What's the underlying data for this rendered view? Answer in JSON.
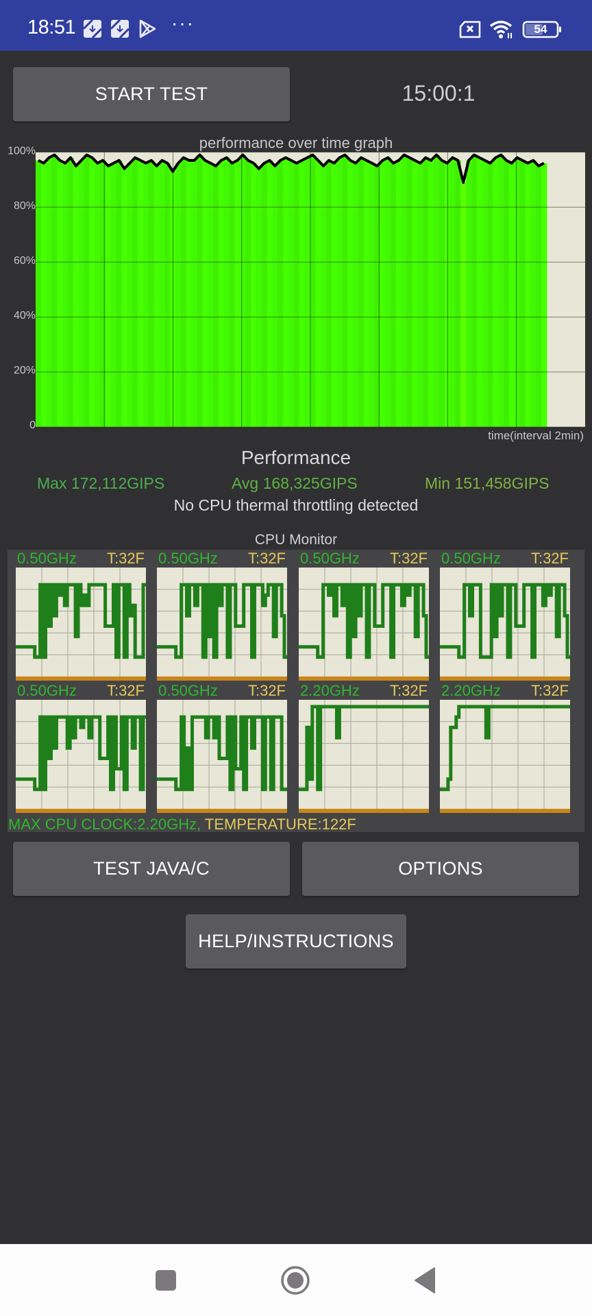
{
  "status_bar": {
    "time": "18:51",
    "notification_icons": [
      "download-box-icon",
      "download-box-icon",
      "play-store-icon"
    ],
    "more_indicator": "···",
    "right_icons": [
      "no-sim-icon",
      "wifi-icon",
      "battery-icon"
    ],
    "battery_level": "54",
    "background_color": "#303f9f"
  },
  "controls": {
    "start_test_label": "START TEST",
    "timer": "15:00:1",
    "test_java_c_label": "TEST JAVA/C",
    "options_label": "OPTIONS",
    "help_label": "HELP/INSTRUCTIONS"
  },
  "performance_graph": {
    "title": "performance over time graph",
    "y_ticks": [
      "100%",
      "80%",
      "60%",
      "40%",
      "20%",
      "0"
    ],
    "x_label": "time(interval 2min)",
    "colors": {
      "fill": "#44ff00",
      "line": "#000000",
      "background": "#e8e6d6",
      "grid": "#2a4a1a"
    }
  },
  "chart_data": {
    "type": "area",
    "title": "performance over time graph",
    "xlabel": "time(interval 2min)",
    "ylabel": "",
    "ylim": [
      0,
      100
    ],
    "y_ticks": [
      0,
      20,
      40,
      60,
      80,
      100
    ],
    "x_intervals_total": 8,
    "x_fraction_filled": 0.93,
    "grid": true,
    "series": [
      {
        "name": "performance %",
        "values": [
          97,
          96,
          98,
          99,
          97,
          96,
          98,
          95,
          97,
          99,
          98,
          96,
          97,
          95,
          96,
          97,
          94,
          96,
          98,
          97,
          96,
          97,
          95,
          97,
          96,
          93,
          96,
          98,
          97,
          97,
          99,
          97,
          96,
          95,
          97,
          98,
          96,
          97,
          99,
          97,
          96,
          94,
          96,
          97,
          95,
          97,
          98,
          97,
          96,
          97,
          98,
          99,
          97,
          95,
          97,
          96,
          98,
          99,
          97,
          96,
          98,
          97,
          96,
          95,
          97,
          98,
          96,
          97,
          99,
          98,
          97,
          96,
          98,
          97,
          99,
          97,
          96,
          98,
          97,
          89,
          97,
          99,
          98,
          97,
          96,
          98,
          99,
          97,
          96,
          98,
          97,
          96,
          97,
          95,
          96
        ]
      }
    ]
  },
  "performance_summary": {
    "title": "Performance",
    "max": "Max 172,112GIPS",
    "avg": "Avg 168,325GIPS",
    "min": "Min 151,458GIPS",
    "throttling": "No CPU thermal throttling detected",
    "colors": {
      "max": "#4caf50",
      "avg": "#5cb342",
      "min": "#7cb342"
    }
  },
  "cpu_monitor": {
    "title": "CPU Monitor",
    "cores": [
      {
        "freq": "0.50GHz",
        "temp": "T:32F",
        "history": [
          0.3,
          0.3,
          0.3,
          0.3,
          0.3,
          0.3,
          0.3,
          0.2,
          0.2,
          0.9,
          0.2,
          0.9,
          0.5,
          0.9,
          0.6,
          0.9,
          0.8,
          0.9,
          0.7,
          0.9,
          0.9,
          0.9,
          0.4,
          0.9,
          0.7,
          0.8,
          0.7,
          0.9,
          0.9,
          0.9,
          0.9,
          0.9,
          0.9,
          0.5,
          0.5,
          0.5,
          0.9,
          0.2,
          0.9,
          0.9,
          0.2,
          0.9,
          0.6,
          0.7,
          0.2,
          0.2,
          0.2,
          0.9
        ]
      },
      {
        "freq": "0.50GHz",
        "temp": "T:32F",
        "history": [
          0.3,
          0.3,
          0.3,
          0.3,
          0.3,
          0.3,
          0.3,
          0.2,
          0.2,
          0.9,
          0.9,
          0.6,
          0.9,
          0.9,
          0.7,
          0.9,
          0.9,
          0.2,
          0.9,
          0.4,
          0.9,
          0.2,
          0.9,
          0.7,
          0.9,
          0.9,
          0.2,
          0.9,
          0.9,
          0.5,
          0.5,
          0.5,
          0.9,
          0.9,
          0.9,
          0.2,
          0.9,
          0.9,
          0.9,
          0.7,
          0.8,
          0.9,
          0.9,
          0.4,
          0.9,
          0.9,
          0.6,
          0.2
        ]
      },
      {
        "freq": "0.50GHz",
        "temp": "T:32F",
        "history": [
          0.3,
          0.3,
          0.3,
          0.3,
          0.3,
          0.3,
          0.3,
          0.2,
          0.2,
          0.9,
          0.9,
          0.8,
          0.9,
          0.6,
          0.9,
          0.9,
          0.7,
          0.9,
          0.2,
          0.9,
          0.4,
          0.9,
          0.6,
          0.9,
          0.9,
          0.2,
          0.9,
          0.9,
          0.5,
          0.5,
          0.5,
          0.9,
          0.9,
          0.9,
          0.2,
          0.9,
          0.9,
          0.9,
          0.7,
          0.9,
          0.8,
          0.9,
          0.9,
          0.4,
          0.9,
          0.9,
          0.6,
          0.2
        ]
      },
      {
        "freq": "0.50GHz",
        "temp": "T:32F",
        "history": [
          0.3,
          0.3,
          0.3,
          0.3,
          0.3,
          0.3,
          0.3,
          0.2,
          0.2,
          0.9,
          0.9,
          0.6,
          0.9,
          0.9,
          0.9,
          0.2,
          0.2,
          0.2,
          0.2,
          0.9,
          0.4,
          0.9,
          0.6,
          0.9,
          0.9,
          0.2,
          0.9,
          0.9,
          0.5,
          0.5,
          0.5,
          0.9,
          0.9,
          0.9,
          0.2,
          0.9,
          0.9,
          0.9,
          0.7,
          0.9,
          0.8,
          0.9,
          0.9,
          0.4,
          0.9,
          0.9,
          0.6,
          0.2
        ]
      },
      {
        "freq": "0.50GHz",
        "temp": "T:32F",
        "history": [
          0.3,
          0.3,
          0.3,
          0.3,
          0.3,
          0.3,
          0.3,
          0.2,
          0.2,
          0.9,
          0.2,
          0.9,
          0.5,
          0.9,
          0.6,
          0.9,
          0.9,
          0.9,
          0.9,
          0.6,
          0.9,
          0.7,
          0.9,
          0.9,
          0.8,
          0.9,
          0.9,
          0.7,
          0.9,
          0.9,
          0.9,
          0.5,
          0.5,
          0.5,
          0.9,
          0.2,
          0.9,
          0.4,
          0.4,
          0.9,
          0.2,
          0.9,
          0.9,
          0.6,
          0.9,
          0.9,
          0.2,
          0.9
        ]
      },
      {
        "freq": "0.50GHz",
        "temp": "T:32F",
        "history": [
          0.3,
          0.3,
          0.3,
          0.3,
          0.3,
          0.3,
          0.3,
          0.2,
          0.2,
          0.9,
          0.2,
          0.6,
          0.2,
          0.9,
          0.9,
          0.9,
          0.9,
          0.9,
          0.7,
          0.9,
          0.9,
          0.7,
          0.9,
          0.5,
          0.5,
          0.5,
          0.9,
          0.2,
          0.9,
          0.4,
          0.4,
          0.9,
          0.2,
          0.9,
          0.9,
          0.6,
          0.9,
          0.9,
          0.9,
          0.2,
          0.9,
          0.9,
          0.2,
          0.9,
          0.9,
          0.9,
          0.2,
          0.2
        ]
      },
      {
        "freq": "2.20GHz",
        "temp": "T:32F",
        "history": [
          0.2,
          0.2,
          0.2,
          0.8,
          0.3,
          1.0,
          1.0,
          0.2,
          1.0,
          1.0,
          1.0,
          1.0,
          1.0,
          1.0,
          0.7,
          1.0,
          1.0,
          1.0,
          1.0,
          1.0,
          1.0,
          1.0,
          1.0,
          1.0,
          1.0,
          1.0,
          1.0,
          1.0,
          1.0,
          1.0,
          1.0,
          1.0,
          1.0,
          1.0,
          1.0,
          1.0,
          1.0,
          1.0,
          1.0,
          1.0,
          1.0,
          1.0,
          1.0,
          1.0,
          1.0,
          1.0,
          1.0,
          1.0
        ]
      },
      {
        "freq": "2.20GHz",
        "temp": "T:32F",
        "history": [
          0.2,
          0.2,
          0.2,
          0.3,
          0.8,
          0.8,
          0.9,
          1.0,
          1.0,
          1.0,
          1.0,
          1.0,
          1.0,
          1.0,
          1.0,
          1.0,
          1.0,
          0.7,
          1.0,
          1.0,
          1.0,
          1.0,
          1.0,
          1.0,
          1.0,
          1.0,
          1.0,
          1.0,
          1.0,
          1.0,
          1.0,
          1.0,
          1.0,
          1.0,
          1.0,
          1.0,
          1.0,
          1.0,
          1.0,
          1.0,
          1.0,
          1.0,
          1.0,
          1.0,
          1.0,
          1.0,
          1.0,
          1.0
        ]
      }
    ],
    "max_cpu_clock": "MAX CPU CLOCK:2.20GHz,",
    "temperature": " TEMPERATURE:122F",
    "colors": {
      "freq": "#2db82d",
      "temp": "#e6c95a",
      "line": "#1f7f1a",
      "bg": "#e8e6d6",
      "base": "#c8861a"
    }
  },
  "nav_bar": {
    "buttons": [
      "recents-button",
      "home-button",
      "back-button"
    ]
  }
}
